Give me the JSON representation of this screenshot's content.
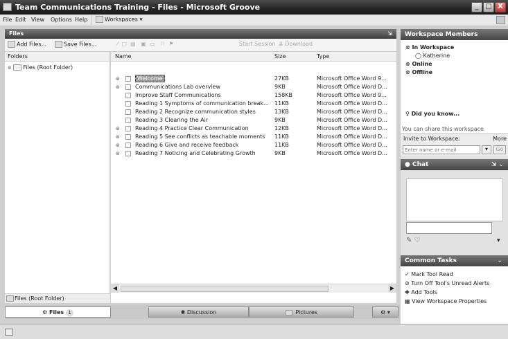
{
  "window": {
    "title": "Team Communications Training - Files - Microsoft Groove",
    "controls": [
      "_",
      "□",
      "X"
    ]
  },
  "menu": {
    "items": [
      "File",
      "Edit",
      "View",
      "Options",
      "Help"
    ],
    "workspaces": "Workspaces"
  },
  "files_panel": {
    "title": "Files"
  },
  "toolbar": {
    "add_files": "Add Files...",
    "save_files": "Save Files...",
    "start_session": "Start Session",
    "download": "Download"
  },
  "folders": {
    "header": "Folders",
    "root": "Files (Root Folder)",
    "bottom": "Files (Root Folder)"
  },
  "columns": {
    "name": "Name",
    "size": "Size",
    "type": "Type"
  },
  "files": [
    {
      "name": "Welcome",
      "size": "27KB",
      "type": "Microsoft Office Word 9..."
    },
    {
      "name": "Communications Lab overview",
      "size": "9KB",
      "type": "Microsoft Office Word D..."
    },
    {
      "name": "Improve Staff Communications",
      "size": "158KB",
      "type": "Microsoft Office Word 9..."
    },
    {
      "name": "Reading 1 Symptoms of communication break...",
      "size": "11KB",
      "type": "Microsoft Office Word D..."
    },
    {
      "name": "Reading 2 Recognize communication styles",
      "size": "13KB",
      "type": "Microsoft Office Word D..."
    },
    {
      "name": "Reading 3 Clearing the Air",
      "size": "9KB",
      "type": "Microsoft Office Word D..."
    },
    {
      "name": "Reading 4  Practice Clear Communication",
      "size": "12KB",
      "type": "Microsoft Office Word D..."
    },
    {
      "name": "Reading 5 See conflicts as teachable moments",
      "size": "11KB",
      "type": "Microsoft Office Word D..."
    },
    {
      "name": "Reading 6 Give and receive feedback",
      "size": "11KB",
      "type": "Microsoft Office Word D..."
    },
    {
      "name": "Reading 7 Noticing and Celebrating Growth",
      "size": "9KB",
      "type": "Microsoft Office Word D..."
    }
  ],
  "tabs": {
    "files": "Files",
    "files_count": "1",
    "discussion": "Discussion",
    "pictures": "Pictures"
  },
  "members": {
    "header": "Workspace Members",
    "in_workspace": "In Workspace",
    "user": "Katherine",
    "online": "Online",
    "offline": "Offline",
    "did_you_know": "Did you know...",
    "tip": "You can share this workspace"
  },
  "invite": {
    "label": "Invite to Workspace:",
    "more": "More",
    "placeholder": "Enter name or e-mail",
    "go": "Go"
  },
  "chat": {
    "header": "Chat"
  },
  "tasks": {
    "header": "Common Tasks",
    "items": [
      "Mark Tool Read",
      "Turn Off Tool's Unread Alerts",
      "Add Tools",
      "View Workspace Properties"
    ]
  }
}
